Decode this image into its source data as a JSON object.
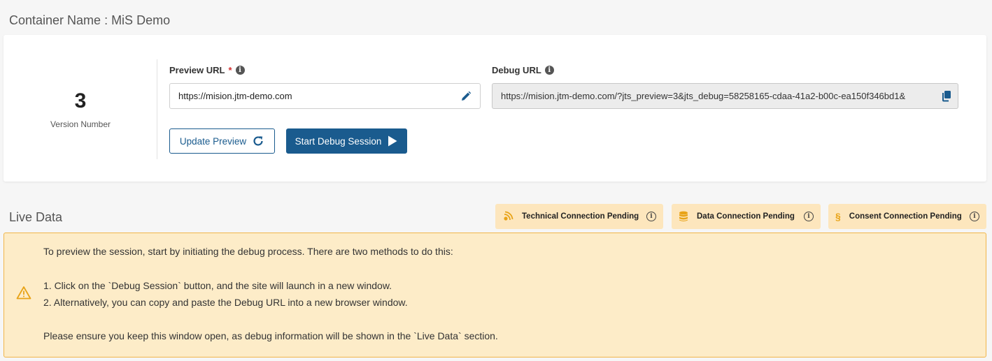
{
  "header": {
    "container_title": "Container Name : MiS Demo"
  },
  "version": {
    "number": "3",
    "label": "Version Number"
  },
  "preview": {
    "label": "Preview URL",
    "required_mark": "*",
    "url": "https://mision.jtm-demo.com"
  },
  "debug": {
    "label": "Debug URL",
    "url": "https://mision.jtm-demo.com/?jts_preview=3&jts_debug=58258165-cdaa-41a2-b00c-ea150f346bd1&"
  },
  "buttons": {
    "update_preview": "Update Preview",
    "start_debug": "Start Debug Session"
  },
  "live_data": {
    "title": "Live Data",
    "badges": [
      {
        "label": "Technical Connection Pending",
        "icon": "signal-icon"
      },
      {
        "label": "Data Connection Pending",
        "icon": "database-icon"
      },
      {
        "label": "Consent Connection Pending",
        "icon": "section-icon"
      }
    ]
  },
  "notice": {
    "line1": "To preview the session, start by initiating the debug process. There are two methods to do this:",
    "line2": "1. Click on the `Debug Session` button, and the site will launch in a new window.",
    "line3": "2. Alternatively, you can copy and paste the Debug URL into a new browser window.",
    "line4": "Please ensure you keep this window open, as debug information will be shown in the `Live Data` section."
  },
  "colors": {
    "primary": "#1a5b8e",
    "badge_bg": "#fde6bd",
    "notice_bg": "#fdecc8",
    "notice_border": "#f0b54a",
    "warning_icon": "#e8a317"
  }
}
